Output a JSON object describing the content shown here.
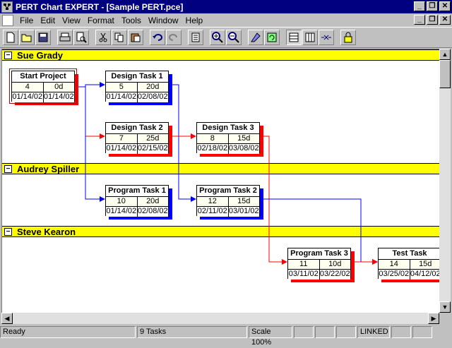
{
  "window": {
    "title": "PERT Chart EXPERT - [Sample PERT.pce]"
  },
  "menu": {
    "items": [
      "File",
      "Edit",
      "View",
      "Format",
      "Tools",
      "Window",
      "Help"
    ]
  },
  "lanes": [
    {
      "name": "Sue Grady"
    },
    {
      "name": "Audrey Spiller"
    },
    {
      "name": "Steve Kearon"
    }
  ],
  "tasks": [
    {
      "name": "Start Project",
      "id": "4",
      "duration": "0d",
      "start": "01/14/02",
      "finish": "01/14/02",
      "shadow": "#ff0000"
    },
    {
      "name": "Design Task 1",
      "id": "5",
      "duration": "20d",
      "start": "01/14/02",
      "finish": "02/08/02",
      "shadow": "#0000ff"
    },
    {
      "name": "Design Task 2",
      "id": "7",
      "duration": "25d",
      "start": "01/14/02",
      "finish": "02/15/02",
      "shadow": "#ff0000"
    },
    {
      "name": "Design Task 3",
      "id": "8",
      "duration": "15d",
      "start": "02/18/02",
      "finish": "03/08/02",
      "shadow": "#ff0000"
    },
    {
      "name": "Program Task 1",
      "id": "10",
      "duration": "20d",
      "start": "01/14/02",
      "finish": "02/08/02",
      "shadow": "#0000ff"
    },
    {
      "name": "Program Task 2",
      "id": "12",
      "duration": "15d",
      "start": "02/11/02",
      "finish": "03/01/02",
      "shadow": "#0000ff"
    },
    {
      "name": "Program Task 3",
      "id": "11",
      "duration": "10d",
      "start": "03/11/02",
      "finish": "03/22/02",
      "shadow": "#ff0000"
    },
    {
      "name": "Test Task",
      "id": "14",
      "duration": "15d",
      "start": "03/25/02",
      "finish": "04/12/02",
      "shadow": "#ff0000"
    }
  ],
  "status": {
    "ready": "Ready",
    "tasks": "9 Tasks",
    "scale": "Scale 100%",
    "linked": "LINKED"
  },
  "colors": {
    "critical": "#ff0000",
    "noncritical": "#0000ff",
    "lane": "#ffff00"
  }
}
